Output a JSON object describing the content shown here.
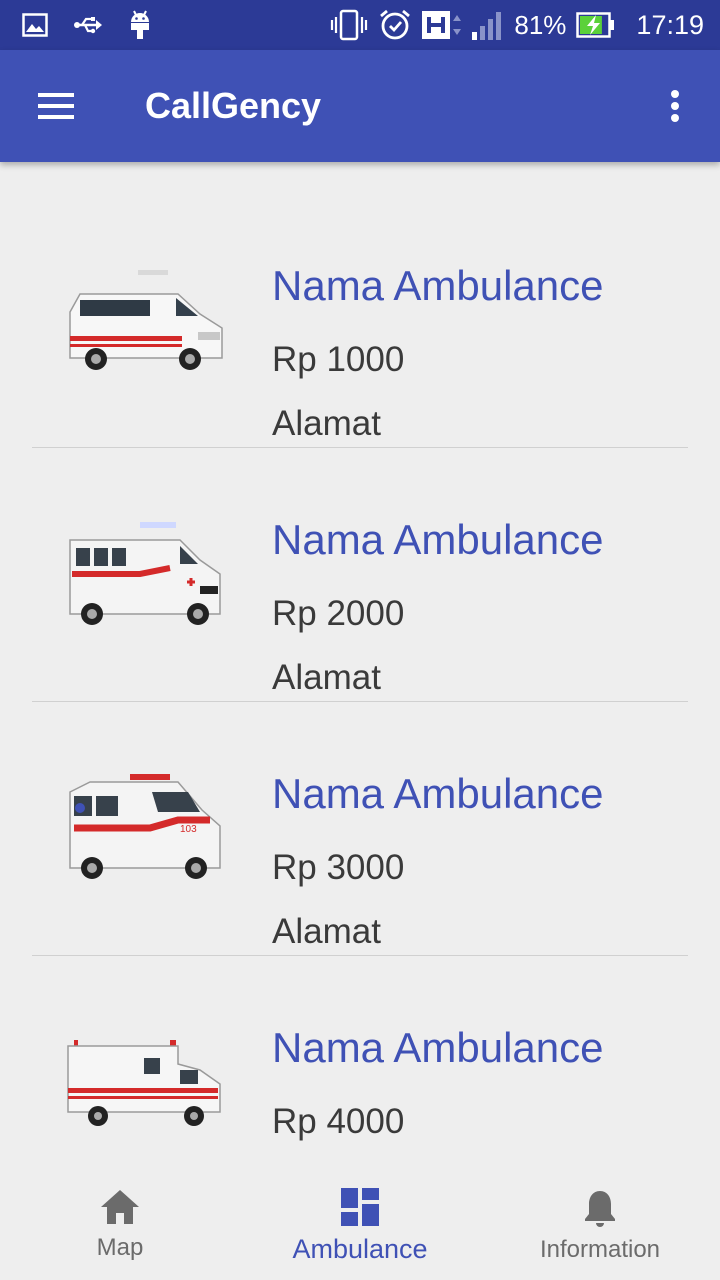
{
  "status_bar": {
    "left_icons": [
      "image-icon",
      "usb-icon",
      "android-icon"
    ],
    "right_icons": [
      "vibrate-icon",
      "alarm-icon",
      "hspa-icon",
      "signal-icon"
    ],
    "battery_percent": "81%",
    "battery_level": 0.81,
    "time": "17:19"
  },
  "app_bar": {
    "title": "CallGency",
    "color": "#3f51b5",
    "status_color": "#2c3a96"
  },
  "ambulances": [
    {
      "name": "Nama Ambulance",
      "price": "Rp 1000",
      "address": "Alamat"
    },
    {
      "name": "Nama Ambulance",
      "price": "Rp 2000",
      "address": "Alamat"
    },
    {
      "name": "Nama Ambulance",
      "price": "Rp 3000",
      "address": "Alamat"
    },
    {
      "name": "Nama Ambulance",
      "price": "Rp 4000",
      "address": ""
    }
  ],
  "bottom_nav": {
    "items": [
      {
        "label": "Map",
        "icon": "home-icon",
        "active": false
      },
      {
        "label": "Ambulance",
        "icon": "dashboard-icon",
        "active": true
      },
      {
        "label": "Information",
        "icon": "bell-icon",
        "active": false
      }
    ]
  }
}
